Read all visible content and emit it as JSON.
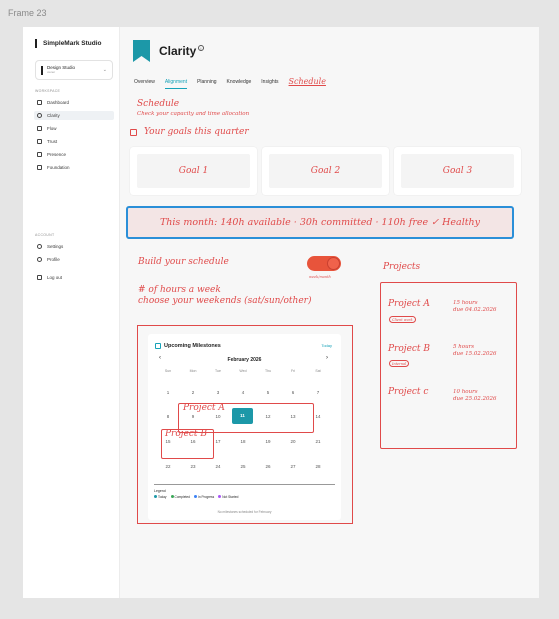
{
  "frame_label": "Frame 23",
  "sidebar": {
    "brand": "SimpleMark Studio",
    "workspace_select": {
      "name": "Design Studio",
      "sub": "owner"
    },
    "workspace_section": "WORKSPACE",
    "items": [
      {
        "label": "Dashboard",
        "icon": "grid-icon"
      },
      {
        "label": "Clarity",
        "icon": "target-icon",
        "active": true
      },
      {
        "label": "Flow",
        "icon": "flow-icon"
      },
      {
        "label": "Trust",
        "icon": "shield-icon"
      },
      {
        "label": "Presence",
        "icon": "megaphone-icon"
      },
      {
        "label": "Foundation",
        "icon": "wrench-icon"
      }
    ],
    "account_section": "ACCOUNT",
    "account_items": [
      {
        "label": "Settings",
        "icon": "gear-icon"
      },
      {
        "label": "Profile",
        "icon": "user-icon"
      },
      {
        "label": "Log out",
        "icon": "logout-icon"
      }
    ]
  },
  "header": {
    "title": "Clarity",
    "info": "i"
  },
  "tabs": [
    "Overview",
    "Alignment",
    "Planning",
    "Knowledge",
    "Insights",
    "Schedule"
  ],
  "schedule": {
    "title": "Schedule",
    "subtitle": "Check your capacity and time allocation",
    "goals_title": "Your goals this quarter",
    "goals": [
      "Goal 1",
      "Goal 2",
      "Goal 3"
    ],
    "month_status": "This month: 140h available · 30h committed · 110h free  ✓ Healthy",
    "build_title": "Build your schedule",
    "toggle_label": "week/month",
    "hours_line1": "# of hours a week",
    "hours_line2": "choose your weekends (sat/sun/other)"
  },
  "projects": {
    "title": "Projects",
    "items": [
      {
        "name": "Project A",
        "hours": "15 hours",
        "due": "due 04.02.2026",
        "tag": "Client work"
      },
      {
        "name": "Project B",
        "hours": "5 hours",
        "due": "due 15.02.2026",
        "tag": "Internal"
      },
      {
        "name": "Project c",
        "hours": "10 hours",
        "due": "due 25.02.2026",
        "tag": ""
      }
    ]
  },
  "calendar": {
    "title": "Upcoming Milestones",
    "today_link": "Today",
    "prev": "‹",
    "next": "›",
    "month": "February 2026",
    "weekdays": [
      "Sun",
      "Mon",
      "Tue",
      "Wed",
      "Thu",
      "Fri",
      "Sat"
    ],
    "weeks": [
      [
        "1",
        "2",
        "3",
        "4",
        "5",
        "6",
        "7"
      ],
      [
        "8",
        "9",
        "10",
        "11",
        "12",
        "13",
        "14"
      ],
      [
        "15",
        "16",
        "17",
        "18",
        "19",
        "20",
        "21"
      ],
      [
        "22",
        "23",
        "24",
        "25",
        "26",
        "27",
        "28"
      ]
    ],
    "today_day": "11",
    "legend_label": "Legend",
    "legend": [
      {
        "label": "Today",
        "color": "#1c98a8"
      },
      {
        "label": "Completed",
        "color": "#3aa757"
      },
      {
        "label": "In Progress",
        "color": "#3b82f6"
      },
      {
        "label": "Not Started",
        "color": "#a855f7"
      }
    ],
    "footer": "No milestones scheduled for February",
    "overlay_a": "Project A",
    "overlay_b": "Project B"
  },
  "colors": {
    "accent": "#17a2b8",
    "annotation": "#e04a4a",
    "highlight_border": "#2a8fd8",
    "toggle": "#e8543b"
  }
}
